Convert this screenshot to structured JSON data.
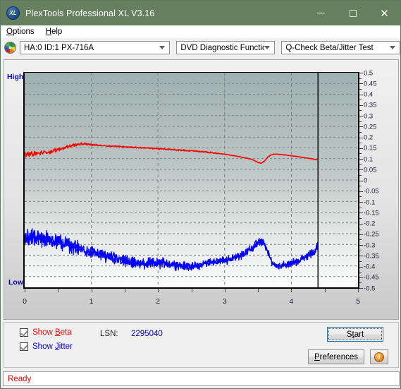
{
  "window": {
    "title": "PlexTools Professional XL V3.16",
    "icon": "xl-logo-icon",
    "minimize": "minimize-icon",
    "maximize": "maximize-icon",
    "close": "close-icon"
  },
  "menubar": {
    "items": [
      {
        "label": "Options",
        "accel": "O"
      },
      {
        "label": "Help",
        "accel": "H"
      }
    ]
  },
  "toolbar": {
    "drive_icon": "optical-disc-icon",
    "drive": {
      "value": "HA:0 ID:1  PX-716A"
    },
    "function": {
      "value": "DVD Diagnostic Functions"
    },
    "test": {
      "value": "Q-Check Beta/Jitter Test"
    }
  },
  "chart_labels": {
    "high": "High",
    "low": "Low"
  },
  "controls": {
    "show_beta": {
      "label_pre": "Show ",
      "accel": "B",
      "label_post": "eta",
      "checked": true
    },
    "show_jitter": {
      "label_pre": "Show ",
      "accel": "J",
      "label_post": "itter",
      "checked": true
    },
    "lsn_label": "LSN:",
    "lsn_value": "2295040",
    "start": {
      "pre": "S",
      "accel": "t",
      "post": "art"
    },
    "preferences": {
      "pre": "",
      "accel": "P",
      "post": "references"
    },
    "info": "i"
  },
  "statusbar": {
    "text": "Ready"
  },
  "colors": {
    "beta": "#ff0000",
    "jitter": "#0000ff",
    "titlebar": "#66805f",
    "plot_bg_top": "#9eb0b0",
    "plot_bg_bottom": "#fdfdfd",
    "axis_label": "#0000d0",
    "status": "#ff0000"
  },
  "chart_data": {
    "type": "line",
    "title": "Q-Check Beta/Jitter Test",
    "xlabel": "",
    "ylabel": "",
    "xlim": [
      0,
      5
    ],
    "ylim": [
      -0.5,
      0.5
    ],
    "grid": true,
    "legend": [
      "Show Beta",
      "Show Jitter"
    ],
    "xticks": [
      0,
      1,
      2,
      3,
      4,
      5
    ],
    "xminor_step": 0.5,
    "yticks": [
      0.5,
      0.45,
      0.4,
      0.35,
      0.3,
      0.25,
      0.2,
      0.15,
      0.1,
      0.05,
      0,
      -0.05,
      -0.1,
      -0.15,
      -0.2,
      -0.25,
      -0.3,
      -0.35,
      -0.4,
      -0.45,
      -0.5
    ],
    "data_end_marker_x": 4.4,
    "series": [
      {
        "name": "Beta",
        "color": "#ff0000",
        "description": "Beta value trace, noisy near start then smooth; dip near x=3.55",
        "x": [
          0.0,
          0.1,
          0.2,
          0.3,
          0.4,
          0.5,
          0.6,
          0.7,
          0.8,
          0.9,
          1.0,
          1.1,
          1.2,
          1.3,
          1.4,
          1.5,
          1.6,
          1.7,
          1.8,
          1.9,
          2.0,
          2.1,
          2.2,
          2.3,
          2.4,
          2.5,
          2.6,
          2.7,
          2.8,
          2.9,
          3.0,
          3.1,
          3.2,
          3.3,
          3.4,
          3.45,
          3.5,
          3.55,
          3.6,
          3.65,
          3.7,
          3.75,
          3.8,
          3.9,
          4.0,
          4.1,
          4.2,
          4.3,
          4.4
        ],
        "y": [
          0.12,
          0.122,
          0.124,
          0.128,
          0.133,
          0.141,
          0.152,
          0.161,
          0.166,
          0.168,
          0.165,
          0.162,
          0.16,
          0.158,
          0.157,
          0.155,
          0.153,
          0.151,
          0.15,
          0.148,
          0.146,
          0.144,
          0.142,
          0.14,
          0.138,
          0.136,
          0.134,
          0.131,
          0.128,
          0.124,
          0.12,
          0.115,
          0.11,
          0.104,
          0.097,
          0.09,
          0.082,
          0.078,
          0.09,
          0.108,
          0.118,
          0.121,
          0.12,
          0.117,
          0.113,
          0.109,
          0.104,
          0.099,
          0.094
        ]
      },
      {
        "name": "Jitter",
        "color": "#0000ff",
        "description": "Jitter noise band; mean descends from about -0.27 to -0.40 then bump near x=3.55",
        "x": [
          0.0,
          0.1,
          0.2,
          0.3,
          0.4,
          0.5,
          0.6,
          0.7,
          0.8,
          0.9,
          1.0,
          1.1,
          1.2,
          1.3,
          1.4,
          1.5,
          1.6,
          1.7,
          1.8,
          1.9,
          2.0,
          2.1,
          2.2,
          2.3,
          2.4,
          2.5,
          2.6,
          2.7,
          2.8,
          2.9,
          3.0,
          3.1,
          3.2,
          3.3,
          3.4,
          3.45,
          3.5,
          3.55,
          3.6,
          3.65,
          3.7,
          3.75,
          3.8,
          3.9,
          4.0,
          4.1,
          4.2,
          4.3,
          4.4
        ],
        "mean": [
          -0.285,
          -0.27,
          -0.268,
          -0.272,
          -0.278,
          -0.286,
          -0.296,
          -0.308,
          -0.32,
          -0.33,
          -0.336,
          -0.344,
          -0.352,
          -0.36,
          -0.368,
          -0.378,
          -0.386,
          -0.39,
          -0.392,
          -0.39,
          -0.388,
          -0.386,
          -0.39,
          -0.396,
          -0.402,
          -0.404,
          -0.398,
          -0.388,
          -0.382,
          -0.378,
          -0.374,
          -0.366,
          -0.354,
          -0.34,
          -0.322,
          -0.306,
          -0.292,
          -0.286,
          -0.3,
          -0.34,
          -0.378,
          -0.396,
          -0.4,
          -0.396,
          -0.388,
          -0.376,
          -0.36,
          -0.34,
          -0.312
        ],
        "band": [
          0.055,
          0.058,
          0.056,
          0.054,
          0.052,
          0.05,
          0.048,
          0.046,
          0.044,
          0.042,
          0.042,
          0.042,
          0.04,
          0.04,
          0.038,
          0.038,
          0.038,
          0.036,
          0.036,
          0.036,
          0.034,
          0.034,
          0.032,
          0.03,
          0.028,
          0.028,
          0.028,
          0.028,
          0.026,
          0.026,
          0.026,
          0.026,
          0.026,
          0.028,
          0.028,
          0.028,
          0.028,
          0.026,
          0.024,
          0.022,
          0.022,
          0.022,
          0.022,
          0.022,
          0.024,
          0.026,
          0.028,
          0.03,
          0.034
        ]
      }
    ]
  }
}
